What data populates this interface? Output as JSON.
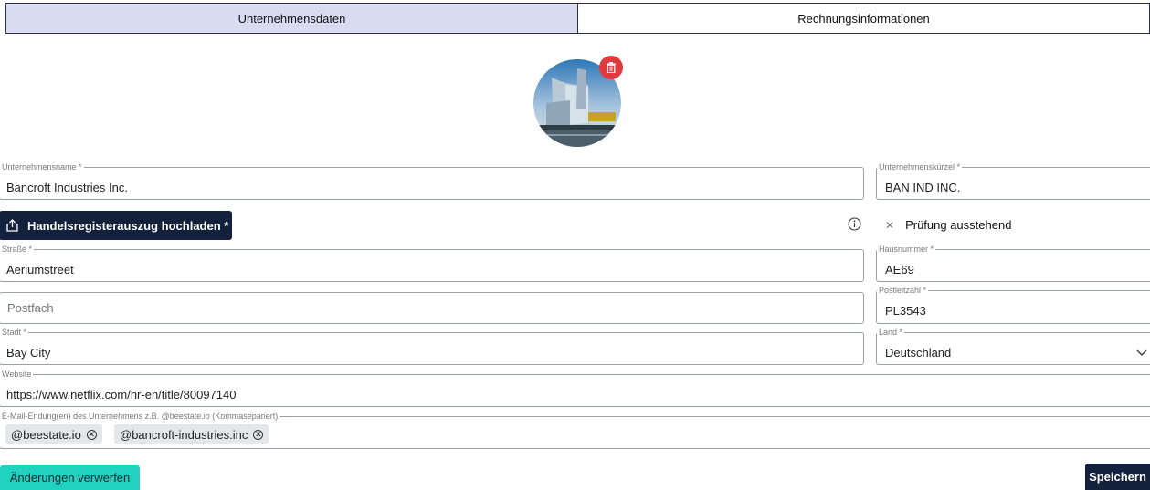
{
  "tabs": [
    {
      "label": "Unternehmensdaten"
    },
    {
      "label": "Rechnungsinformationen"
    }
  ],
  "fields": {
    "company_name": {
      "label": "Unternehmensname *",
      "value": "Bancroft Industries Inc."
    },
    "company_short": {
      "label": "Unternehmenskürzel *",
      "value": "BAN IND INC."
    },
    "street": {
      "label": "Straße *",
      "value": "Aeriumstreet"
    },
    "house_number": {
      "label": "Hausnummer *",
      "value": "AE69"
    },
    "po_box": {
      "placeholder": "Postfach"
    },
    "postal_code": {
      "label": "Postleitzahl *",
      "value": "PL3543"
    },
    "city": {
      "label": "Stadt *",
      "value": "Bay City"
    },
    "country": {
      "label": "Land *",
      "value": "Deutschland"
    },
    "website": {
      "label": "Website",
      "value": "https://www.netflix.com/hr-en/title/80097140"
    },
    "email_domains": {
      "label": "E-Mail-Endung(en) des Unternehmens z.B. @beestate.io (Kommasepariert)",
      "chips": [
        "@beestate.io",
        "@bancroft-industries.inc"
      ]
    }
  },
  "upload": {
    "label": "Handelsregisterauszug hochladen *"
  },
  "verification": {
    "status": "Prüfung ausstehend"
  },
  "actions": {
    "discard": "Änderungen verwerfen",
    "save": "Speichern"
  },
  "icons": {
    "upload": "upload-icon",
    "info": "info-icon",
    "delete": "trash-icon",
    "dropdown": "chevron-down-icon",
    "chip_remove": "circle-x-icon"
  },
  "colors": {
    "tab_active": "#d9dcf1",
    "primary_dark": "#13213d",
    "accent_teal": "#21d2c0",
    "delete_red": "#e0393e"
  }
}
